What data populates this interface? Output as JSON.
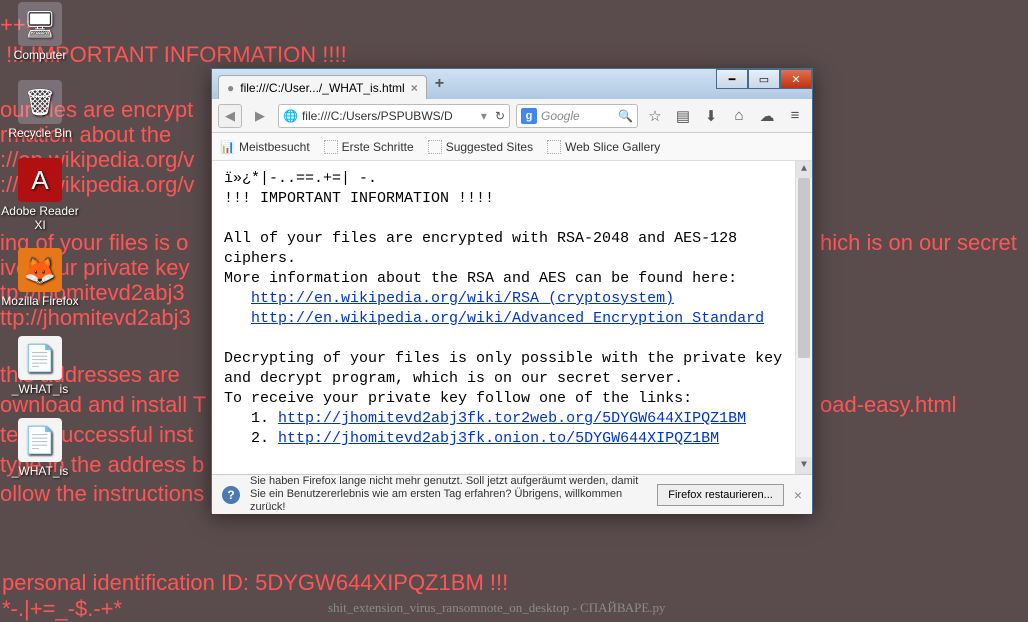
{
  "desktop": {
    "icons": [
      {
        "label": "Computer",
        "glyph": "🖥"
      },
      {
        "label": "Recycle Bin",
        "glyph": "🗑"
      },
      {
        "label": "Adobe Reader XI",
        "glyph": "📕"
      },
      {
        "label": "Mozilla Firefox",
        "glyph": "🦊"
      },
      {
        "label": "_WHAT_is",
        "glyph": "📄"
      },
      {
        "label": "_WHAT_is",
        "glyph": "📄"
      }
    ]
  },
  "background_text": {
    "l1": "++=-.",
    "l2": " !!! IMPORTANT INFORMATION !!!!",
    "l3": "our files are encrypt",
    "l4": "rmation about the",
    "l5": "://en.wikipedia.org/v",
    "l6": "://en.wikipedia.org/v",
    "l7": "ing of your files is o",
    "l7b": "hich is on our secret",
    "l8": "ive your private key",
    "l9": "tp://jhomitevd2abj3",
    "l10": "ttp://jhomitevd2abj3",
    "l11": "this addresses are",
    "l12": "ownload and install T",
    "l12b": "oad-easy.html",
    "l13": "ter a successful inst",
    "l14": "type in the address b",
    "l15": "ollow the instructions on the site.",
    "l16": " personal identification ID: 5DYGW644XIPQZ1BM !!!",
    "l17": "*-.|+=_-$.-+*"
  },
  "watermark": "shit_extension_virus_ransomnote_on_desktop - СПАЙВАРЕ.ру",
  "browser": {
    "tab_title": "file:///C:/User.../_WHAT_is.html",
    "url": "file:///C:/Users/PSPUBWS/D",
    "search_placeholder": "Google",
    "bookmarks": [
      "Meistbesucht",
      "Erste Schritte",
      "Suggested Sites",
      "Web Slice Gallery"
    ],
    "content": {
      "line1": "ï»¿*|-..==.+=| -.",
      "line2": "       !!! IMPORTANT INFORMATION !!!!",
      "para1": "All of your files are encrypted with RSA-2048 and AES-128 ciphers.",
      "para2": "More information about the RSA and AES can be found here:",
      "link1": "http://en.wikipedia.org/wiki/RSA_(cryptosystem)",
      "link2": "http://en.wikipedia.org/wiki/Advanced_Encryption_Standard",
      "para3": "Decrypting of your files is only possible with the private key and decrypt program, which is on our secret server.",
      "para4": "To receive your private key follow one of the links:",
      "link3": "http://jhomitevd2abj3fk.tor2web.org/5DYGW644XIPQZ1BM",
      "link4": "http://jhomitevd2abj3fk.onion.to/5DYGW644XIPQZ1BM",
      "num1": "1. ",
      "num2": "2. "
    },
    "infobar": {
      "message": "Sie haben Firefox lange nicht mehr genutzt. Soll jetzt aufgeräumt werden, damit Sie ein Benutzererlebnis wie am ersten Tag erfahren? Übrigens, willkommen zurück!",
      "button": "Firefox restaurieren..."
    }
  }
}
